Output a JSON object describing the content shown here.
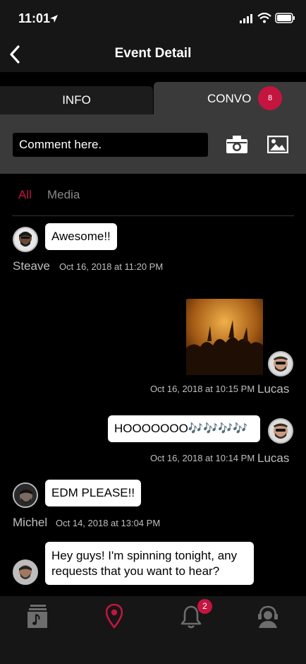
{
  "status_bar": {
    "time": "11:01"
  },
  "nav": {
    "title": "Event Detail"
  },
  "tabs": {
    "info": "INFO",
    "convo": "CONVO",
    "convo_badge": "8"
  },
  "comment": {
    "placeholder": "Comment here."
  },
  "filters": {
    "all": "All",
    "media": "Media"
  },
  "messages": [
    {
      "author": "Steave",
      "text": "Awesome!!",
      "timestamp": "Oct 16, 2018 at 11:20 PM"
    },
    {
      "author": "Lucas",
      "text": "",
      "timestamp": "Oct 16, 2018 at 10:15 PM"
    },
    {
      "author": "Lucas",
      "text": "HOOOOOOO🎶🎶🎶🎶",
      "timestamp": "Oct 16, 2018 at 10:14 PM"
    },
    {
      "author": "Michel",
      "text": "EDM PLEASE!!",
      "timestamp": "Oct 14, 2018 at 13:04 PM"
    },
    {
      "author": "",
      "text": "Hey guys! I'm spinning tonight, any requests that you want to hear?",
      "timestamp": ""
    }
  ],
  "tabbar": {
    "notifications_badge": "2"
  },
  "colors": {
    "accent": "#c4153f",
    "panel": "#3a3a3a",
    "bar": "#161616"
  }
}
